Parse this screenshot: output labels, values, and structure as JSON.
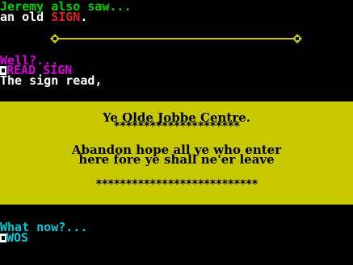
{
  "screen": {
    "intro_line1": "Jeremy also saw...",
    "intro_line2_prefix": "an old ",
    "intro_line2_object": "SIGN",
    "intro_line2_suffix": ".",
    "prompt1": "Well?...",
    "command1": "READ SIGN",
    "response1": "The sign read,",
    "prompt2": "What now?...",
    "command2": "WOS"
  },
  "sign": {
    "title": "Ye Olde Jobbe Centre.",
    "title_underline": "*********************",
    "body_line1": "Abandon hope all ye who enter",
    "body_line2": "here fore ye shall ne'er leave",
    "footer_stars": "***************************"
  },
  "colors": {
    "background": "#000000",
    "green": "#00d000",
    "magenta": "#d800d8",
    "red": "#e02020",
    "cyan": "#00c8d8",
    "sign_background": "#c8c800",
    "divider": "#c8c800"
  },
  "icons": {
    "input_cursor": "input-chevron-icon",
    "divider_end": "diamond-icon"
  }
}
